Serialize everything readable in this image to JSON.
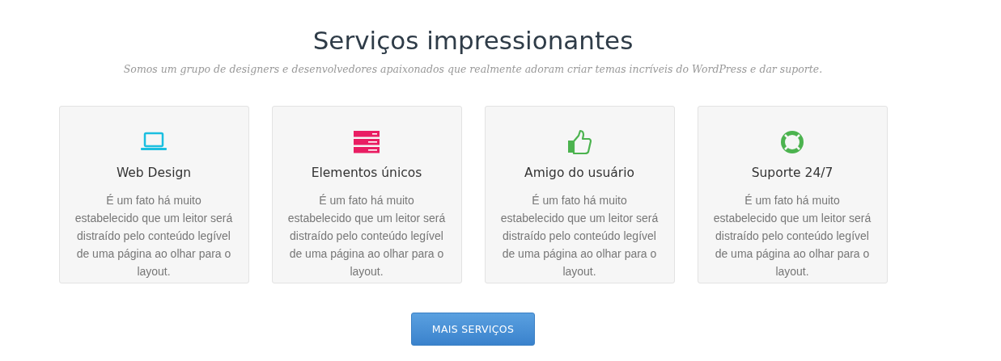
{
  "heading": "Serviços impressionantes",
  "subheading": "Somos um grupo de designers e desenvolvedores apaixonados que realmente adoram criar temas incríveis do WordPress e dar suporte.",
  "services": [
    {
      "kind": "laptop",
      "color": "#1bbfe0",
      "title": "Web Design",
      "text": "É um fato há muito estabelecido que um leitor será distraído pelo conteúdo legível de uma página ao olhar para o layout."
    },
    {
      "kind": "server",
      "color": "#e91e63",
      "title": "Elementos únicos",
      "text": "É um fato há muito estabelecido que um leitor será distraído pelo conteúdo legível de uma página ao olhar para o layout."
    },
    {
      "kind": "thumb",
      "color": "#4cb34f",
      "title": "Amigo do usuário",
      "text": "É um fato há muito estabelecido que um leitor será distraído pelo conteúdo legível de uma página ao olhar para o layout."
    },
    {
      "kind": "lifebuoy",
      "color": "#4cb34f",
      "title": "Suporte 24/7",
      "text": "É um fato há muito estabelecido que um leitor será distraído pelo conteúdo legível de uma página ao olhar para o layout."
    }
  ],
  "button": "MAIS SERVIÇOS"
}
